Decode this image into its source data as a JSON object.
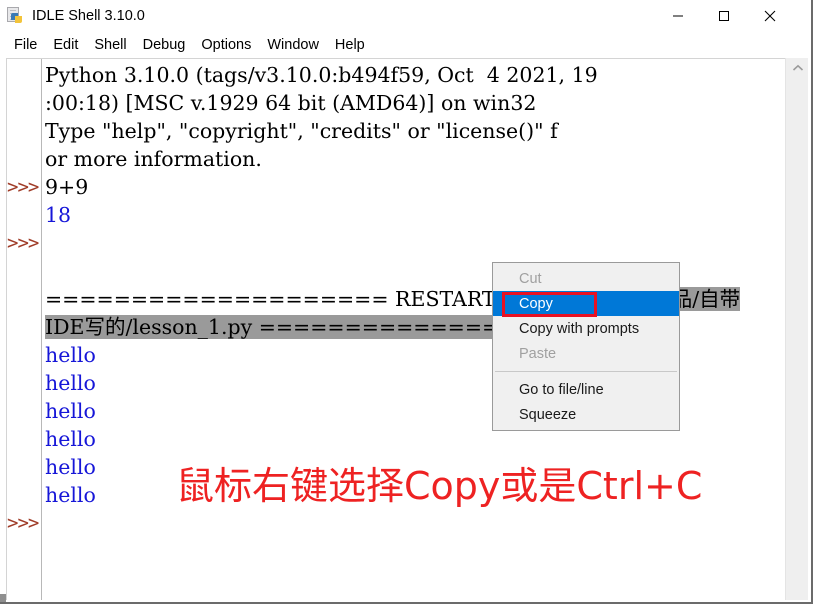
{
  "window": {
    "title": "IDLE Shell 3.10.0",
    "icon": "python-idle-icon",
    "controls": {
      "minimize": "minimize-icon",
      "maximize": "maximize-icon",
      "close": "close-icon"
    }
  },
  "menubar": {
    "items": [
      {
        "label": "File"
      },
      {
        "label": "Edit"
      },
      {
        "label": "Shell"
      },
      {
        "label": "Debug"
      },
      {
        "label": "Options"
      },
      {
        "label": "Window"
      },
      {
        "label": "Help"
      }
    ]
  },
  "shell": {
    "prompt": ">>>",
    "lines": [
      {
        "text": "Python 3.10.0 (tags/v3.10.0:b494f59, Oct  4 2021, 19",
        "color": "black",
        "prompt": false
      },
      {
        "text": ":00:18) [MSC v.1929 64 bit (AMD64)] on win32",
        "color": "black",
        "prompt": false
      },
      {
        "text": "Type \"help\", \"copyright\", \"credits\" or \"license()\" f",
        "color": "black",
        "prompt": false
      },
      {
        "text": "or more information.",
        "color": "black",
        "prompt": false
      },
      {
        "text": "9+9",
        "color": "black",
        "prompt": true
      },
      {
        "text": "18",
        "color": "blue",
        "prompt": false
      },
      {
        "text": "",
        "color": "black",
        "prompt": true
      },
      {
        "text": "",
        "color": "black",
        "prompt": false
      },
      {
        "text": "==================== RESTART: D:/少儿python作品/自带",
        "color": "black",
        "prompt": false,
        "selection_from": 30
      },
      {
        "text": "IDE写的/lesson_1.py ====================",
        "color": "black",
        "prompt": false,
        "selection_all": true
      },
      {
        "text": "hello",
        "color": "blue",
        "prompt": false
      },
      {
        "text": "hello",
        "color": "blue",
        "prompt": false
      },
      {
        "text": "hello",
        "color": "blue",
        "prompt": false
      },
      {
        "text": "hello",
        "color": "blue",
        "prompt": false
      },
      {
        "text": "hello",
        "color": "blue",
        "prompt": false
      },
      {
        "text": "hello",
        "color": "blue",
        "prompt": false
      },
      {
        "text": "",
        "color": "black",
        "prompt": true
      }
    ],
    "restart_path": "D:/少儿python作品/自带IDE写的/lesson_1.py",
    "colors": {
      "prompt": "#a03c28",
      "output": "#1616d8",
      "selection": "#9a9a9a"
    }
  },
  "context_menu": {
    "items": [
      {
        "label": "Cut",
        "state": "disabled"
      },
      {
        "label": "Copy",
        "state": "selected"
      },
      {
        "label": "Copy with prompts",
        "state": "normal"
      },
      {
        "label": "Paste",
        "state": "disabled"
      },
      {
        "label": "---",
        "state": "separator"
      },
      {
        "label": "Go to file/line",
        "state": "normal"
      },
      {
        "label": "Squeeze",
        "state": "normal"
      }
    ],
    "highlight_color": "#0078d7",
    "annotation_box_color": "#e81123"
  },
  "annotation": {
    "text": "鼠标右键选择Copy或是Ctrl+C",
    "color": "#ee2222"
  },
  "scrollbar": {
    "up_arrow": "chevron-up-icon"
  }
}
